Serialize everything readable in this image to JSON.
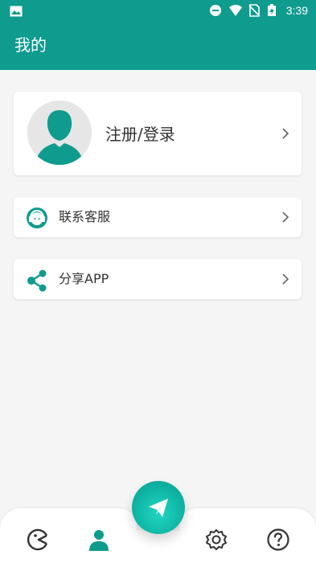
{
  "colors": {
    "primary": "#0f9b8e",
    "background": "#f5f5f5",
    "text": "#333333",
    "muted": "#555555",
    "fab_gradient_start": "#20d7c1",
    "fab_gradient_end": "#0c9e90"
  },
  "status_bar": {
    "time": "3:39",
    "icons": [
      "image-icon",
      "do-not-disturb-icon",
      "wifi-icon",
      "no-sim-icon",
      "battery-charging-icon"
    ]
  },
  "header": {
    "title": "我的"
  },
  "profile": {
    "label": "注册/登录",
    "avatar_icon": "user-silhouette-icon",
    "chevron_icon": "chevron-right-icon"
  },
  "menu": [
    {
      "label": "联系客服",
      "icon": "customer-service-headset-icon"
    },
    {
      "label": "分享APP",
      "icon": "share-icon"
    }
  ],
  "bottom_nav": {
    "items": [
      {
        "icon": "pacman-home-icon"
      },
      {
        "icon": "person-icon",
        "selected": true
      },
      {
        "icon": "gear-icon"
      },
      {
        "icon": "question-icon"
      }
    ],
    "fab_icon": "paper-plane-icon"
  }
}
